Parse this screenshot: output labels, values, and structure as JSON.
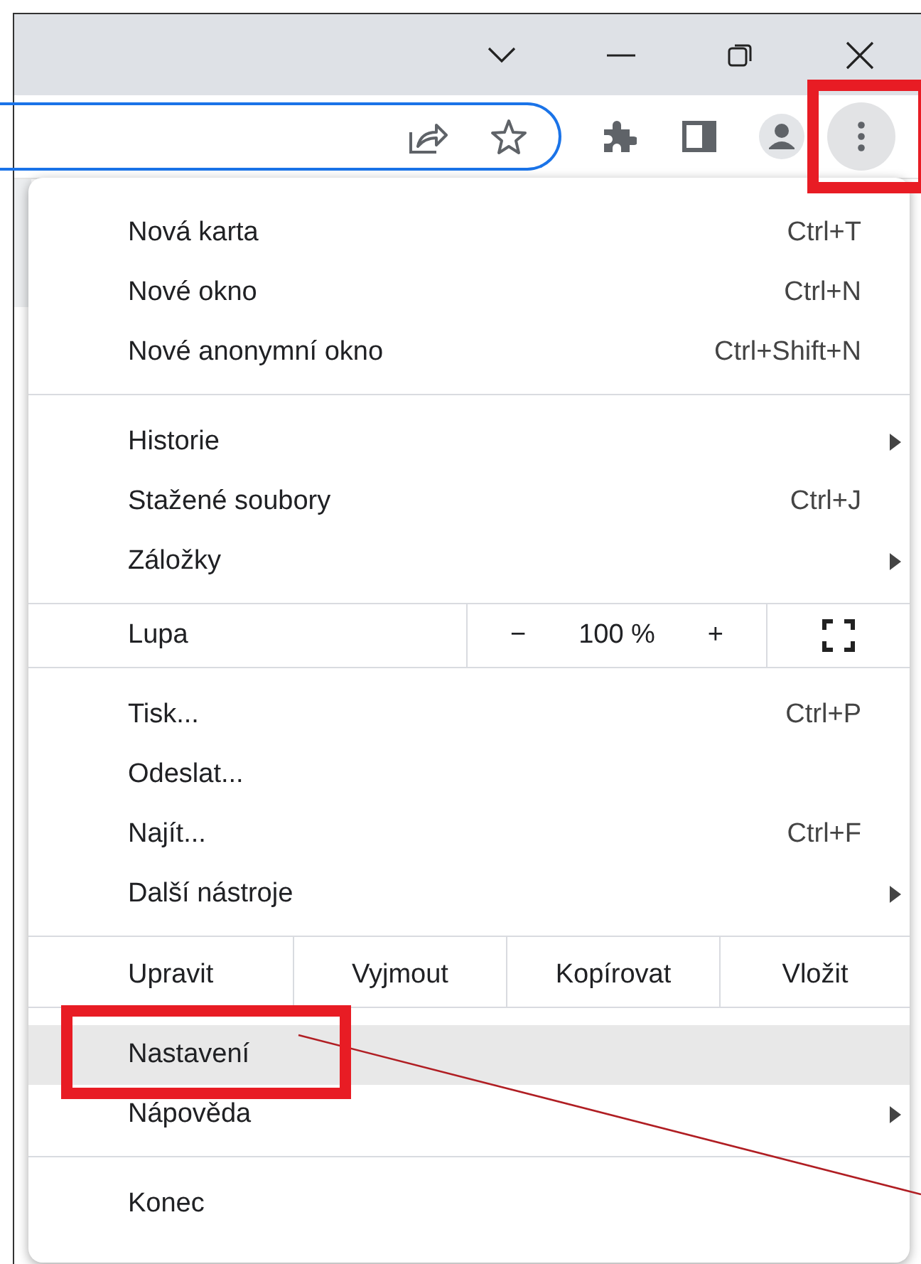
{
  "title_bar": {
    "buttons": [
      {
        "kind": "tab-search"
      },
      {
        "kind": "minimize"
      },
      {
        "kind": "restore"
      },
      {
        "kind": "close"
      }
    ]
  },
  "toolbar": {
    "address_icons": [
      {
        "kind": "share"
      },
      {
        "kind": "star"
      }
    ],
    "buttons": [
      {
        "kind": "extensions"
      },
      {
        "kind": "side-panel"
      },
      {
        "kind": "profile"
      },
      {
        "kind": "menu",
        "marked": true
      }
    ]
  },
  "menu": {
    "groups": [
      [
        {
          "kind": "item",
          "label": "Nová karta",
          "shortcut": "Ctrl+T",
          "highlighted": false,
          "marked": false
        },
        {
          "kind": "item",
          "label": "Nové okno",
          "shortcut": "Ctrl+N",
          "highlighted": false,
          "marked": false
        },
        {
          "kind": "item",
          "label": "Nové anonymní okno",
          "shortcut": "Ctrl+Shift+N",
          "highlighted": false,
          "marked": false
        }
      ],
      [
        {
          "kind": "submenu",
          "label": "Historie",
          "highlighted": false,
          "marked": false
        },
        {
          "kind": "item",
          "label": "Stažené soubory",
          "shortcut": "Ctrl+J",
          "highlighted": false,
          "marked": false
        },
        {
          "kind": "submenu",
          "label": "Záložky",
          "highlighted": false,
          "marked": false
        }
      ],
      [
        {
          "kind": "zoom",
          "label": "Lupa",
          "minus": "−",
          "value": "100 %",
          "plus": "+"
        }
      ],
      [
        {
          "kind": "item",
          "label": "Tisk...",
          "shortcut": "Ctrl+P",
          "highlighted": false,
          "marked": false
        },
        {
          "kind": "item",
          "label": "Odeslat...",
          "highlighted": false,
          "marked": false
        },
        {
          "kind": "item",
          "label": "Najít...",
          "shortcut": "Ctrl+F",
          "highlighted": false,
          "marked": false
        },
        {
          "kind": "submenu",
          "label": "Další nástroje",
          "highlighted": false,
          "marked": false
        }
      ],
      [
        {
          "kind": "edit",
          "label": "Upravit",
          "actions": [
            "Vyjmout",
            "Kopírovat",
            "Vložit"
          ]
        }
      ],
      [
        {
          "kind": "item",
          "label": "Nastavení",
          "highlighted": true,
          "marked": true
        },
        {
          "kind": "submenu",
          "label": "Nápověda",
          "highlighted": false,
          "marked": false
        }
      ],
      [
        {
          "kind": "item",
          "label": "Konec",
          "highlighted": false,
          "marked": false
        }
      ]
    ]
  }
}
